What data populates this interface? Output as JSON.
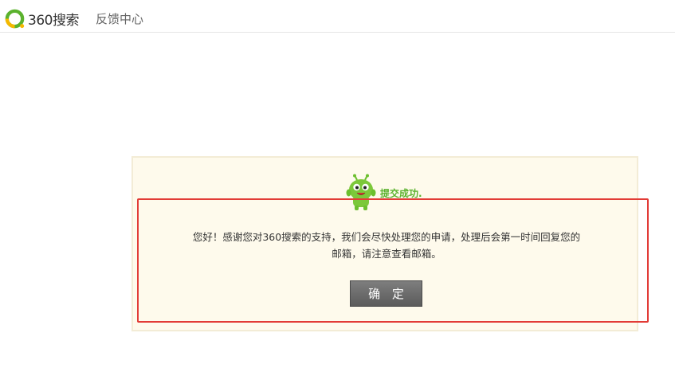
{
  "header": {
    "logo_text": "360搜索",
    "title": "反馈中心"
  },
  "dialog": {
    "success_text": "提交成功.",
    "message_line1": "您好！感谢您对360搜索的支持，我们会尽快处理您的申请，处理后会第一时间回复您的",
    "message_line2": "邮箱，请注意查看邮箱。",
    "confirm_label": "确 定"
  },
  "colors": {
    "brand_green": "#5bb22e",
    "logo_yellow": "#f5b800",
    "highlight_red": "#e23b36",
    "panel_bg": "#fefaec"
  },
  "icons": [
    "360-logo-icon",
    "mascot-icon"
  ]
}
